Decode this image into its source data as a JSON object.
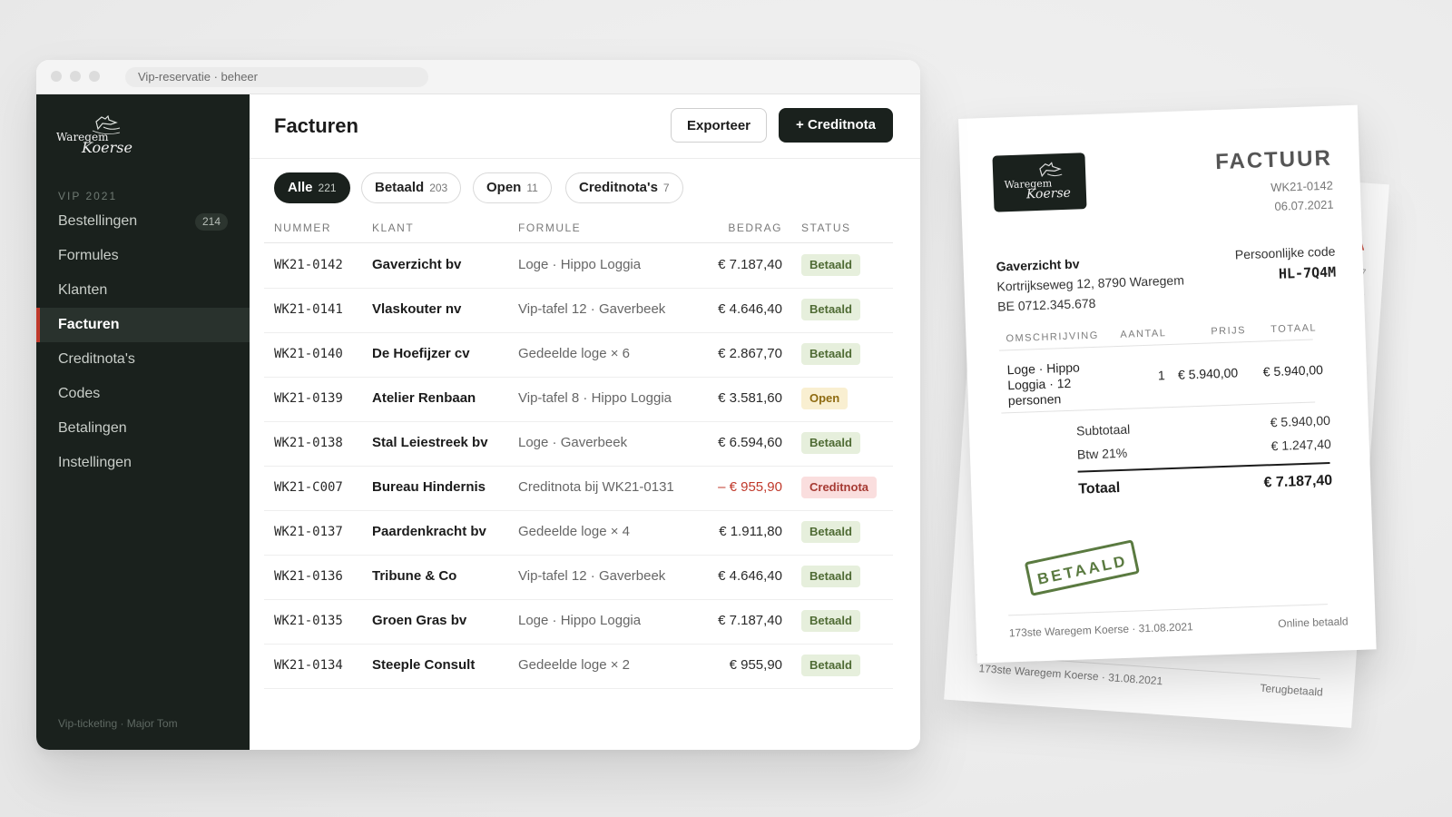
{
  "window": {
    "url": "Vip-reservatie · beheer"
  },
  "sidebar": {
    "logo_text_1": "Waregem",
    "logo_text_2": "Koerse",
    "section": "VIP 2021",
    "items": [
      {
        "label": "Bestellingen",
        "badge": "214"
      },
      {
        "label": "Formules"
      },
      {
        "label": "Klanten"
      },
      {
        "label": "Facturen",
        "active": true
      },
      {
        "label": "Creditnota's"
      },
      {
        "label": "Codes"
      },
      {
        "label": "Betalingen"
      },
      {
        "label": "Instellingen"
      }
    ],
    "footer": "Vip-ticketing · Major Tom"
  },
  "main": {
    "title": "Facturen",
    "export_label": "Exporteer",
    "new_credit_label": "+ Creditnota",
    "filters": [
      {
        "label": "Alle",
        "count": "221",
        "active": true
      },
      {
        "label": "Betaald",
        "count": "203"
      },
      {
        "label": "Open",
        "count": "11"
      },
      {
        "label": "Creditnota's",
        "count": "7"
      }
    ],
    "columns": {
      "nummer": "NUMMER",
      "klant": "KLANT",
      "formule": "FORMULE",
      "bedrag": "BEDRAG",
      "status": "STATUS"
    },
    "rows": [
      {
        "nummer": "WK21-0142",
        "klant": "Gaverzicht bv",
        "formule": "Loge · Hippo Loggia",
        "bedrag": "€ 7.187,40",
        "status": "Betaald",
        "kind": "paid"
      },
      {
        "nummer": "WK21-0141",
        "klant": "Vlaskouter nv",
        "formule": "Vip-tafel 12 · Gaverbeek",
        "bedrag": "€ 4.646,40",
        "status": "Betaald",
        "kind": "paid"
      },
      {
        "nummer": "WK21-0140",
        "klant": "De Hoefijzer cv",
        "formule": "Gedeelde loge × 6",
        "bedrag": "€ 2.867,70",
        "status": "Betaald",
        "kind": "paid"
      },
      {
        "nummer": "WK21-0139",
        "klant": "Atelier Renbaan",
        "formule": "Vip-tafel 8 · Hippo Loggia",
        "bedrag": "€ 3.581,60",
        "status": "Open",
        "kind": "open"
      },
      {
        "nummer": "WK21-0138",
        "klant": "Stal Leiestreek bv",
        "formule": "Loge · Gaverbeek",
        "bedrag": "€ 6.594,60",
        "status": "Betaald",
        "kind": "paid"
      },
      {
        "nummer": "WK21-C007",
        "klant": "Bureau Hindernis",
        "formule": "Creditnota bij WK21-0131",
        "bedrag": "– € 955,90",
        "status": "Creditnota",
        "kind": "credit"
      },
      {
        "nummer": "WK21-0137",
        "klant": "Paardenkracht bv",
        "formule": "Gedeelde loge × 4",
        "bedrag": "€ 1.911,80",
        "status": "Betaald",
        "kind": "paid"
      },
      {
        "nummer": "WK21-0136",
        "klant": "Tribune & Co",
        "formule": "Vip-tafel 12 · Gaverbeek",
        "bedrag": "€ 4.646,40",
        "status": "Betaald",
        "kind": "paid"
      },
      {
        "nummer": "WK21-0135",
        "klant": "Groen Gras bv",
        "formule": "Loge · Hippo Loggia",
        "bedrag": "€ 7.187,40",
        "status": "Betaald",
        "kind": "paid"
      },
      {
        "nummer": "WK21-0134",
        "klant": "Steeple Consult",
        "formule": "Gedeelde loge × 2",
        "bedrag": "€ 955,90",
        "status": "Betaald",
        "kind": "paid"
      }
    ]
  },
  "invoice": {
    "title": "FACTUUR",
    "number": "WK21-0142",
    "date": "06.07.2021",
    "client": "Gaverzicht bv",
    "address": "Kortrijkseweg 12, 8790 Waregem",
    "vat": "BE 0712.345.678",
    "code_label": "Persoonlijke code",
    "code": "HL-7Q4M",
    "th_desc": "OMSCHRIJVING",
    "th_qty": "AANTAL",
    "th_price": "PRIJS",
    "th_total": "TOTAAL",
    "line_desc": "Loge · Hippo Loggia · 12 personen",
    "line_qty": "1",
    "line_price": "€ 5.940,00",
    "line_total": "€ 5.940,00",
    "subtotal_label": "Subtotaal",
    "subtotal": "€ 5.940,00",
    "vat_label": "Btw 21%",
    "vat_amount": "€ 1.247,40",
    "total_label": "Totaal",
    "total": "€ 7.187,40",
    "stamp": "BETAALD",
    "footer_left": "173ste Waregem Koerse · 31.08.2021",
    "footer_right": "Online betaald"
  },
  "invoice_back": {
    "title_fragment": "A",
    "frag_1": "07",
    "frag_2": "31",
    "frag_3": "e",
    "footer_left": "173ste Waregem Koerse · 31.08.2021",
    "footer_right": "Terugbetaald"
  },
  "colors": {
    "sidebar_bg": "#1a211d",
    "accent_red": "#c0392b",
    "paid_green": "#4f6b34",
    "open_amber": "#8e6a10"
  }
}
